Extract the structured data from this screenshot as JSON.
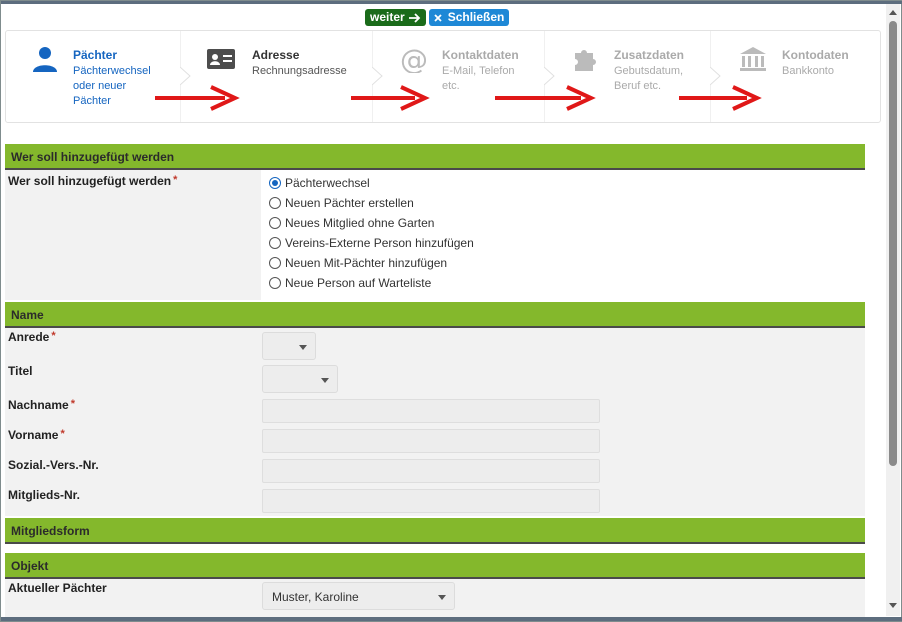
{
  "top_buttons": {
    "weiter": "weiter",
    "schliessen": "Schließen"
  },
  "steps": [
    {
      "title": "Pächter",
      "sub": "Pächterwechsel oder neuer Pächter",
      "icon": "user-icon",
      "active": true
    },
    {
      "title": "Adresse",
      "sub": "Rechnungsadresse",
      "icon": "address-card-icon",
      "active": false
    },
    {
      "title": "Kontaktdaten",
      "sub": "E-Mail, Telefon etc.",
      "icon": "at-icon",
      "active": false
    },
    {
      "title": "Zusatzdaten",
      "sub": "Gebutsdatum, Beruf etc.",
      "icon": "puzzle-icon",
      "active": false
    },
    {
      "title": "Kontodaten",
      "sub": "Bankkonto",
      "icon": "bank-icon",
      "active": false
    }
  ],
  "sections": {
    "wer": "Wer soll hinzugefügt werden",
    "name": "Name",
    "mitgliedsform": "Mitgliedsform",
    "objekt": "Objekt"
  },
  "wer_field": {
    "label": "Wer soll hinzugefügt werden",
    "required_mark": "*",
    "options": [
      "Pächterwechsel",
      "Neuen Pächter erstellen",
      "Neues Mitglied ohne Garten",
      "Vereins-Externe Person hinzufügen",
      "Neuen Mit-Pächter hinzufügen",
      "Neue Person auf Warteliste"
    ],
    "selected": "Pächterwechsel"
  },
  "name_fields": {
    "anrede": {
      "label": "Anrede",
      "required": "*",
      "value": ""
    },
    "titel": {
      "label": "Titel",
      "value": ""
    },
    "nachname": {
      "label": "Nachname",
      "required": "*",
      "value": ""
    },
    "vorname": {
      "label": "Vorname",
      "required": "*",
      "value": ""
    },
    "sozial": {
      "label": "Sozial.-Vers.-Nr.",
      "value": ""
    },
    "mitglieds": {
      "label": "Mitglieds-Nr.",
      "value": ""
    }
  },
  "objekt_fields": {
    "aktueller_paechter": {
      "label": "Aktueller Pächter",
      "value": "Muster, Karoline"
    }
  },
  "colors": {
    "accent": "#84b82c",
    "active_step": "#1565c0",
    "weiter": "#1a6b1a",
    "close": "#1e88d6",
    "arrow": "#e01818"
  }
}
